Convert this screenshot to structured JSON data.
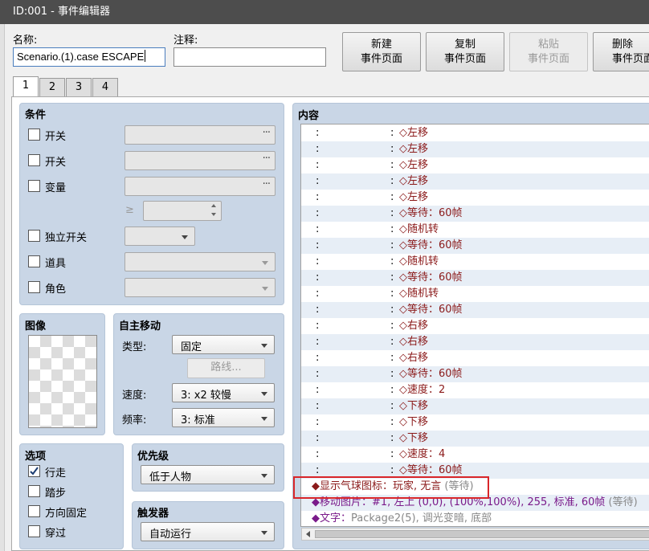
{
  "window": {
    "title": "ID:001 - 事件编辑器"
  },
  "header": {
    "name_label": "名称:",
    "name_value": "Scenario.(1).case ESCAPE",
    "note_label": "注释:",
    "note_value": "",
    "buttons": [
      {
        "line1": "新建",
        "line2": "事件页面",
        "enabled": true
      },
      {
        "line1": "复制",
        "line2": "事件页面",
        "enabled": true
      },
      {
        "line1": "粘贴",
        "line2": "事件页面",
        "enabled": false
      },
      {
        "line1": "删除",
        "line2": "事件页面",
        "enabled": true
      }
    ]
  },
  "tabs": [
    "1",
    "2",
    "3",
    "4"
  ],
  "conditions": {
    "title": "条件",
    "switch1": "开关",
    "switch2": "开关",
    "variable": "变量",
    "ge": "≥",
    "self_switch": "独立开关",
    "item": "道具",
    "actor": "角色",
    "ellipsis": "···"
  },
  "image": {
    "title": "图像"
  },
  "autonomous": {
    "title": "自主移动",
    "type_label": "类型:",
    "type_value": "固定",
    "route_button": "路线...",
    "speed_label": "速度:",
    "speed_value": "3: x2 较慢",
    "freq_label": "频率:",
    "freq_value": "3: 标准"
  },
  "options": {
    "title": "选项",
    "items": [
      {
        "label": "行走",
        "checked": true
      },
      {
        "label": "踏步",
        "checked": false
      },
      {
        "label": "方向固定",
        "checked": false
      },
      {
        "label": "穿过",
        "checked": false
      }
    ]
  },
  "priority": {
    "title": "优先级",
    "value": "低于人物"
  },
  "trigger": {
    "title": "触发器",
    "value": "自动运行"
  },
  "content": {
    "title": "内容",
    "move_rows": [
      {
        "colon": ":",
        "sep": ":",
        "text": "◇左移"
      },
      {
        "colon": ":",
        "sep": ":",
        "text": "◇左移"
      },
      {
        "colon": ":",
        "sep": ":",
        "text": "◇左移"
      },
      {
        "colon": ":",
        "sep": ":",
        "text": "◇左移"
      },
      {
        "colon": ":",
        "sep": ":",
        "text": "◇左移"
      },
      {
        "colon": ":",
        "sep": ":",
        "text": "◇等待：60帧"
      },
      {
        "colon": ":",
        "sep": ":",
        "text": "◇随机转"
      },
      {
        "colon": ":",
        "sep": ":",
        "text": "◇等待：60帧"
      },
      {
        "colon": ":",
        "sep": ":",
        "text": "◇随机转"
      },
      {
        "colon": ":",
        "sep": ":",
        "text": "◇等待：60帧"
      },
      {
        "colon": ":",
        "sep": ":",
        "text": "◇随机转"
      },
      {
        "colon": ":",
        "sep": ":",
        "text": "◇等待：60帧"
      },
      {
        "colon": ":",
        "sep": ":",
        "text": "◇右移"
      },
      {
        "colon": ":",
        "sep": ":",
        "text": "◇右移"
      },
      {
        "colon": ":",
        "sep": ":",
        "text": "◇右移"
      },
      {
        "colon": ":",
        "sep": ":",
        "text": "◇等待：60帧"
      },
      {
        "colon": ":",
        "sep": ":",
        "text": "◇速度：2"
      },
      {
        "colon": ":",
        "sep": ":",
        "text": "◇下移"
      },
      {
        "colon": ":",
        "sep": ":",
        "text": "◇下移"
      },
      {
        "colon": ":",
        "sep": ":",
        "text": "◇下移"
      },
      {
        "colon": ":",
        "sep": ":",
        "text": "◇速度：4"
      },
      {
        "colon": ":",
        "sep": ":",
        "text": "◇等待：60帧"
      }
    ],
    "balloon": {
      "main": "◆显示气球图标：玩家, 无言",
      "suffix": " (等待)"
    },
    "picture": {
      "main": "◆移动图片：#1, 左上 (0,0), (100%,100%), 255, 标准, 60帧",
      "suffix": " (等待)"
    },
    "text_cmd": {
      "head": "◆文字：",
      "body": "Package2(5), 调光变暗, 底部"
    }
  },
  "colors": {
    "highlight_box": "#d9262a",
    "group_bg": "#c9d6e6",
    "command_red": "#8b1a1a",
    "command_purple": "#7a1a8a"
  }
}
